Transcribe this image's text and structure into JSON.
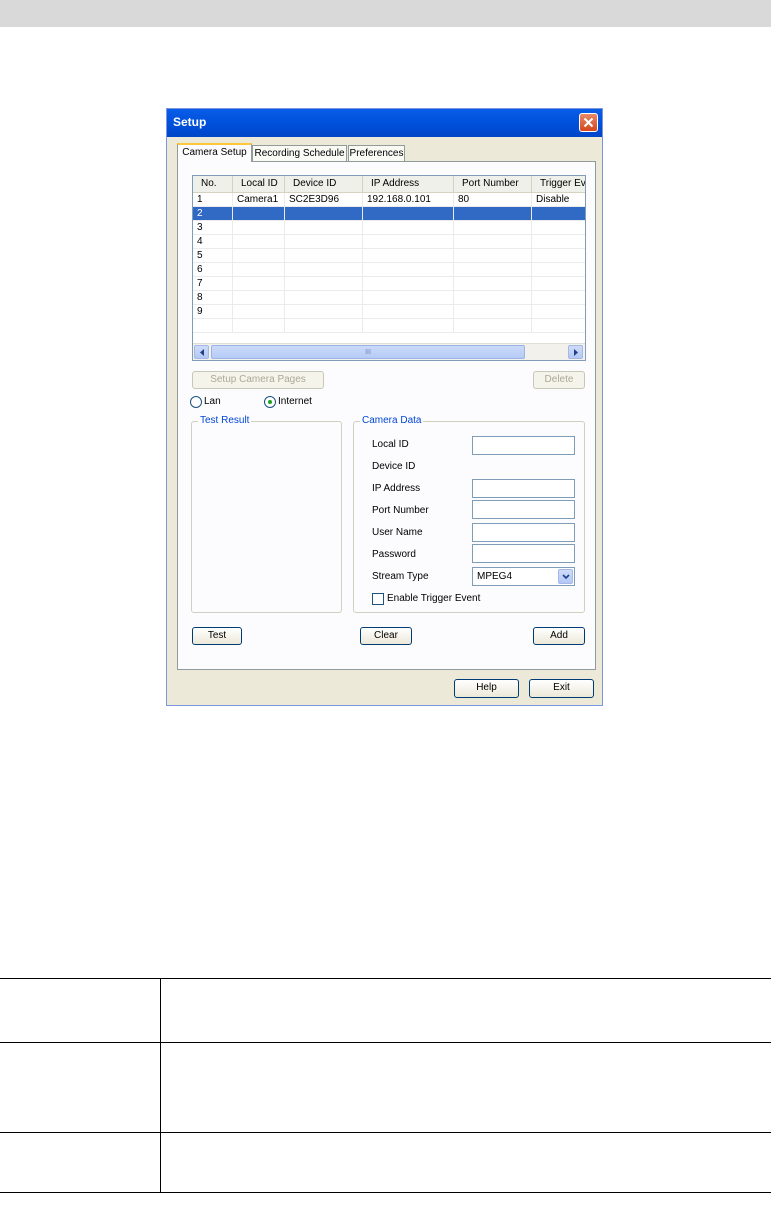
{
  "window": {
    "title": "Setup"
  },
  "tabs": [
    "Camera Setup",
    "Recording Schedule",
    "Preferences"
  ],
  "grid": {
    "columns": [
      "No.",
      "Local ID",
      "Device ID",
      "IP Address",
      "Port Number",
      "Trigger Ev"
    ],
    "rows": [
      [
        "1",
        "Camera1",
        "SC2E3D96",
        "192.168.0.101",
        "80",
        "Disable"
      ],
      [
        "2",
        "",
        "",
        "",
        "",
        ""
      ],
      [
        "3",
        "",
        "",
        "",
        "",
        ""
      ],
      [
        "4",
        "",
        "",
        "",
        "",
        ""
      ],
      [
        "5",
        "",
        "",
        "",
        "",
        ""
      ],
      [
        "6",
        "",
        "",
        "",
        "",
        ""
      ],
      [
        "7",
        "",
        "",
        "",
        "",
        ""
      ],
      [
        "8",
        "",
        "",
        "",
        "",
        ""
      ],
      [
        "9",
        "",
        "",
        "",
        "",
        ""
      ],
      [
        "",
        "",
        "",
        "",
        "",
        ""
      ]
    ],
    "selected_row": 2,
    "scroll_thumb_glyph": "III"
  },
  "buttons": {
    "setup_camera_pages": "Setup Camera Pages",
    "delete": "Delete",
    "test": "Test",
    "clear": "Clear",
    "add": "Add",
    "help": "Help",
    "exit": "Exit"
  },
  "connection": {
    "lan": "Lan",
    "internet": "Internet",
    "selected": "Internet"
  },
  "test_result": {
    "legend": "Test Result"
  },
  "camera_data": {
    "legend": "Camera Data",
    "local_id_label": "Local ID",
    "device_id_label": "Device ID",
    "ip_address_label": "IP Address",
    "port_number_label": "Port Number",
    "user_name_label": "User Name",
    "password_label": "Password",
    "stream_type_label": "Stream Type",
    "stream_type_value": "MPEG4",
    "enable_trigger_label": "Enable Trigger Event",
    "enable_trigger_checked": false
  },
  "colors": {
    "title_bar": "#0a5de8",
    "selection": "#316ac5",
    "tab_highlight": "#ffc83c",
    "radio_dot": "#21a121"
  }
}
